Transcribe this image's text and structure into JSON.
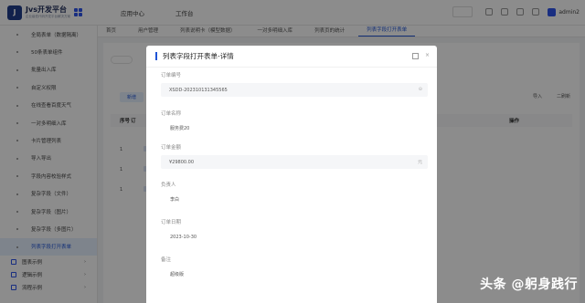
{
  "app": {
    "logo_letter": "J",
    "title": "Jvs开发平台",
    "subtitle": "企业级低代码开发平台解决方案"
  },
  "topnav": [
    "应用中心",
    "工作台"
  ],
  "user": {
    "name": "admin2"
  },
  "tabs": [
    "首页",
    "用户管理",
    "列表说明卡（模型数据）",
    "一对多明细入库",
    "列表页的统计",
    "列表字段打开表单"
  ],
  "sidebar": {
    "items": [
      "全局表单（数据隔离）",
      "50条表单组件",
      "批量出入库",
      "自定义权限",
      "在线查看百度天气",
      "一对多明细入库",
      "卡片管理列表",
      "导入导出",
      "字段内容校验样式",
      "复杂字段（文件）",
      "复杂字段（图片）",
      "复杂字段（多图片）",
      "列表字段打开表单"
    ],
    "active_index": 12,
    "groups": [
      "图表示例",
      "逻辑示例",
      "流程示例"
    ]
  },
  "content": {
    "new_button": "新增",
    "right_links": [
      "导入",
      "二刷新"
    ],
    "columns": {
      "num": "序号",
      "order": "订",
      "op": "操作"
    },
    "rows": [
      "1",
      "1",
      "1"
    ]
  },
  "modal": {
    "title": "列表字段打开表单-详情",
    "close": "×",
    "fields": [
      {
        "label": "订单编号",
        "value": "XSDD-202310131345565"
      },
      {
        "label": "订单名称",
        "value": "服务费20"
      },
      {
        "label": "订单金额",
        "value": "¥29800.00",
        "suffix": "元"
      },
      {
        "label": "负责人",
        "value": "李白"
      },
      {
        "label": "订单日期",
        "value": "2023-10-30"
      },
      {
        "label": "备注",
        "value": "超级版"
      }
    ]
  },
  "watermark": "头条 @躬身践行"
}
